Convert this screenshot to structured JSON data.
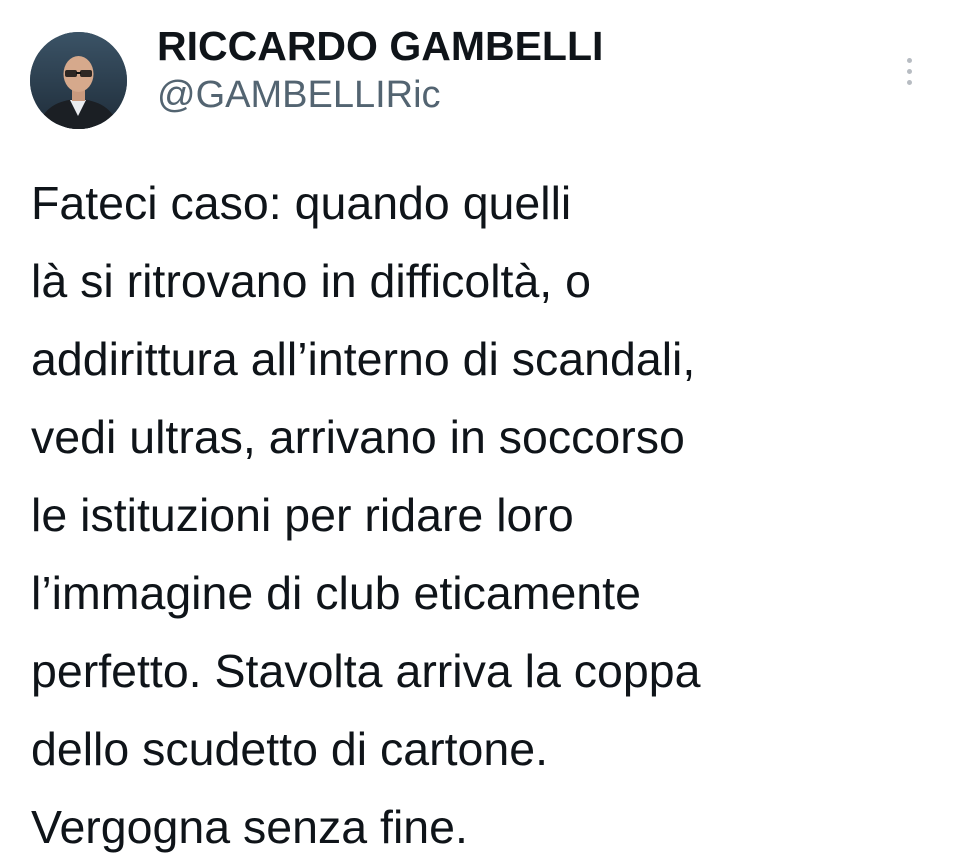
{
  "tweet": {
    "author": {
      "display_name": "RICCARDO GAMBELLI",
      "handle": "@GAMBELLIRic",
      "avatar_icon": "profile-photo"
    },
    "more_icon": "more-vertical-icon",
    "text_lines": [
      "Fateci caso: quando quelli",
      "là si ritrovano in difficoltà, o",
      "addirittura all’interno di scandali,",
      "vedi ultras, arrivano in soccorso",
      "le istituzioni per ridare loro",
      "l’immagine di club eticamente",
      "perfetto. Stavolta arriva la coppa",
      "dello scudetto di cartone.",
      "Vergogna senza fine."
    ]
  },
  "colors": {
    "text_primary": "#0f1419",
    "text_secondary": "#536471",
    "background": "#ffffff"
  }
}
